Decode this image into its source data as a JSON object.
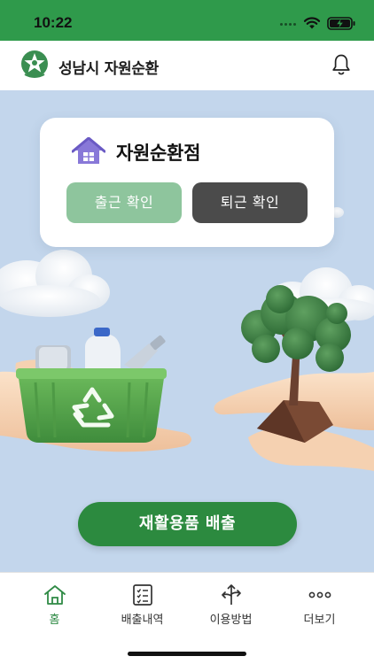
{
  "status_bar": {
    "time": "10:22"
  },
  "app_bar": {
    "title": "성남시 자원순환"
  },
  "card": {
    "title": "자원순환점",
    "check_in_label": "출근 확인",
    "check_out_label": "퇴근 확인"
  },
  "main": {
    "submit_label": "재활용품 배출"
  },
  "tabs": [
    {
      "label": "홈",
      "icon": "home-icon",
      "active": true
    },
    {
      "label": "배출내역",
      "icon": "list-icon",
      "active": false
    },
    {
      "label": "이용방법",
      "icon": "directions-icon",
      "active": false
    },
    {
      "label": "더보기",
      "icon": "more-icon",
      "active": false
    }
  ],
  "colors": {
    "status_bar": "#2f9a4b",
    "background": "#c3d6ec",
    "check_in": "#8ec59d",
    "check_out": "#4b4b4b",
    "primary": "#2c8a3f"
  }
}
